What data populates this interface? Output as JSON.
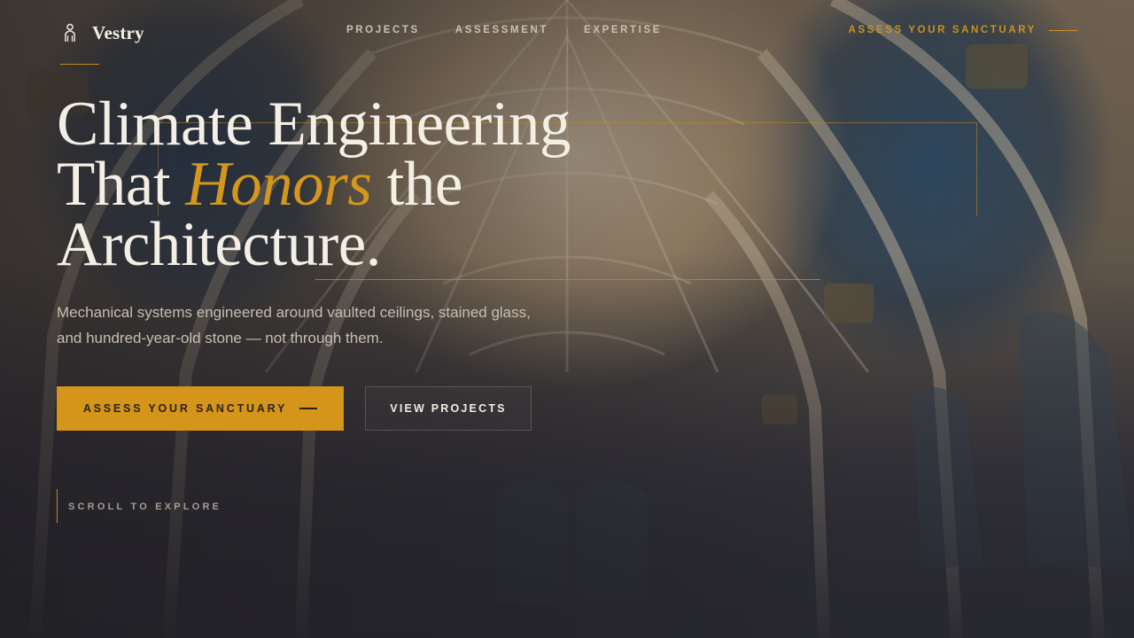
{
  "brand": {
    "name": "Vestry",
    "icon": "sanctuary-figure-icon"
  },
  "nav": {
    "links": [
      "PROJECTS",
      "ASSESSMENT",
      "EXPERTISE"
    ],
    "cta": "ASSESS YOUR SANCTUARY"
  },
  "hero": {
    "headline_line1": "Climate Engineering",
    "headline_line2_pre": "That ",
    "headline_line2_accent": "Honors",
    "headline_line2_post": " the",
    "headline_line3": "Architecture.",
    "subtitle_line1": "Mechanical systems engineered around vaulted ceilings, stained glass,",
    "subtitle_line2": "and hundred-year-old stone — not through them.",
    "primary_button": "ASSESS YOUR SANCTUARY",
    "secondary_button": "VIEW PROJECTS",
    "scroll_label": "SCROLL TO EXPLORE"
  },
  "colors": {
    "accent": "#d4951a",
    "text_light": "#f4efe4",
    "background_dark": "#2d2d35"
  }
}
